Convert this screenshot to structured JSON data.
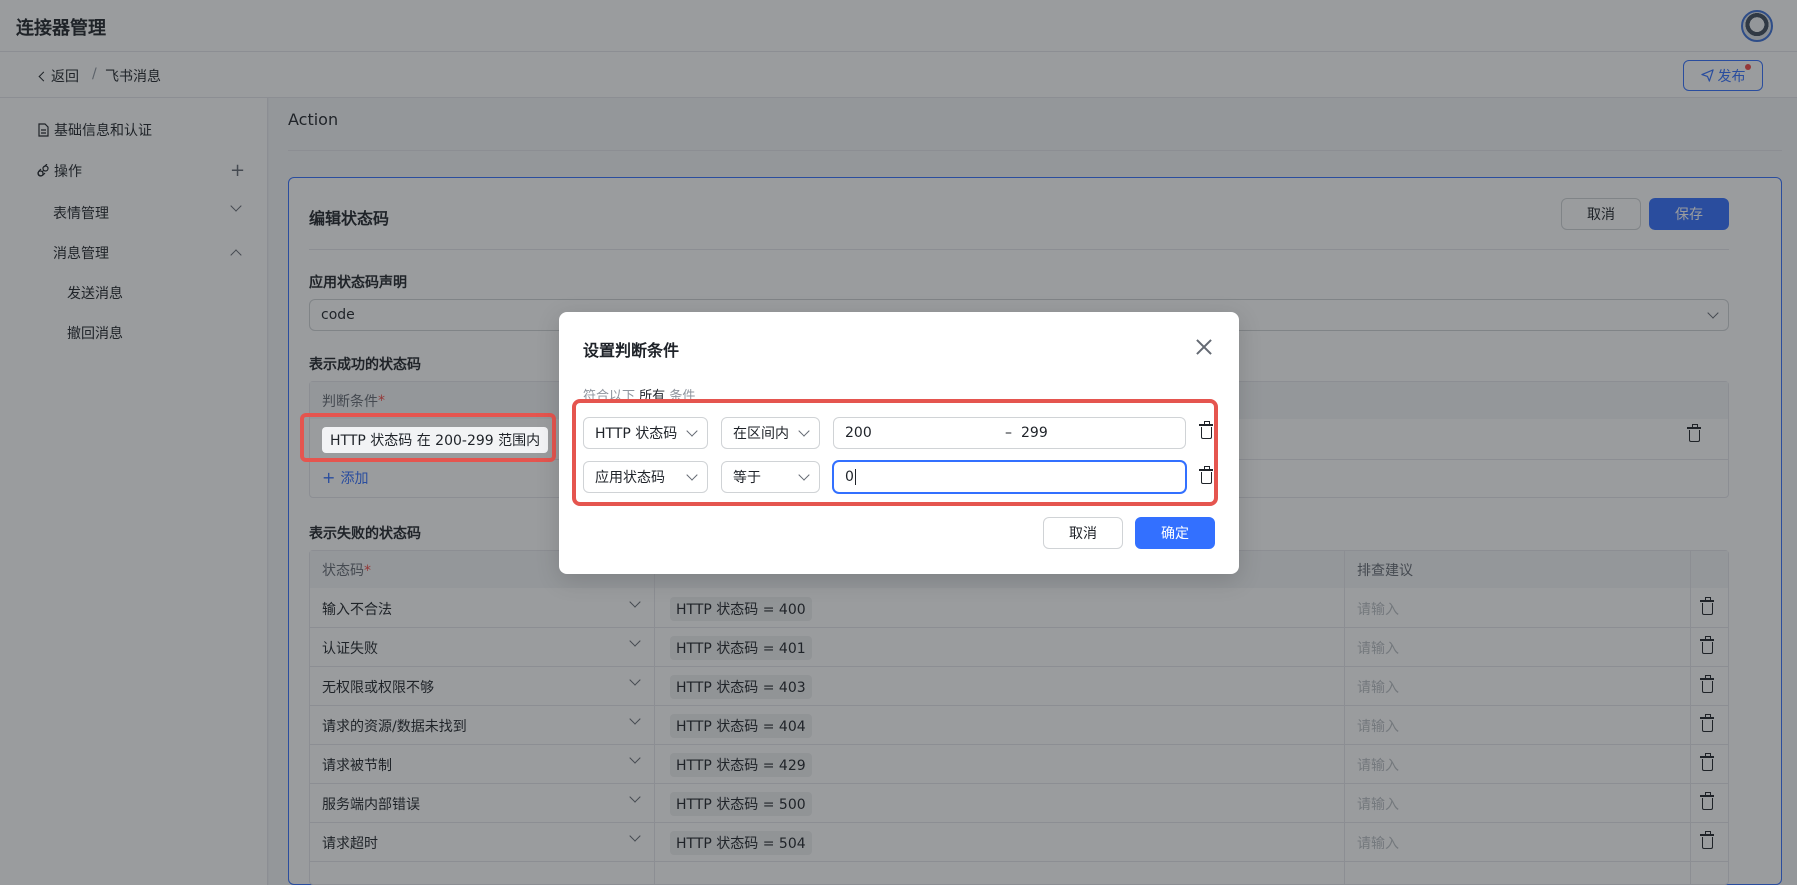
{
  "app": {
    "title": "连接器管理"
  },
  "breadcrumb": {
    "back": "返回",
    "separator": "/",
    "current": "飞书消息"
  },
  "header": {
    "publish_label": "发布"
  },
  "sidebar": {
    "items": [
      {
        "label": "基础信息和认证",
        "icon": "document-icon"
      },
      {
        "label": "操作",
        "icon": "link-icon"
      },
      {
        "label": "表情管理"
      },
      {
        "label": "消息管理"
      },
      {
        "label": "发送消息"
      },
      {
        "label": "撤回消息"
      }
    ]
  },
  "main": {
    "section_title": "Action",
    "card": {
      "title": "编辑状态码",
      "cancel_label": "取消",
      "save_label": "保存",
      "app_code_label": "应用状态码声明",
      "app_code_value": "code",
      "success_label": "表示成功的状态码",
      "success_table": {
        "header_condition": "判断条件",
        "required_mark": "*",
        "row_condition": "HTTP 状态码 在 200-299 范围内",
        "add_label": "添加"
      },
      "failure_label": "表示失败的状态码",
      "failure_table": {
        "col_code": "状态码",
        "col_suggest": "排查建议",
        "required_mark": "*",
        "placeholder": "请输入",
        "rows": [
          {
            "name": "输入不合法",
            "condition": "HTTP 状态码 = 400"
          },
          {
            "name": "认证失败",
            "condition": "HTTP 状态码 = 401"
          },
          {
            "name": "无权限或权限不够",
            "condition": "HTTP 状态码 = 403"
          },
          {
            "name": "请求的资源/数据未找到",
            "condition": "HTTP 状态码 = 404"
          },
          {
            "name": "请求被节制",
            "condition": "HTTP 状态码 = 429"
          },
          {
            "name": "服务端内部错误",
            "condition": "HTTP 状态码 = 500"
          },
          {
            "name": "请求超时",
            "condition": "HTTP 状态码 = 504"
          }
        ]
      }
    }
  },
  "modal": {
    "title": "设置判断条件",
    "subtitle_prefix": "符合以下",
    "subtitle_all": "所有",
    "subtitle_suffix": "条件",
    "conditions": [
      {
        "field": "HTTP 状态码",
        "operator": "在区间内",
        "value_from": "200",
        "range_sep": "–",
        "value_to": "299"
      },
      {
        "field": "应用状态码",
        "operator": "等于",
        "value": "0"
      }
    ],
    "cancel_label": "取消",
    "confirm_label": "确定"
  },
  "colors": {
    "primary": "#3370ff",
    "highlight": "#e5554f"
  }
}
